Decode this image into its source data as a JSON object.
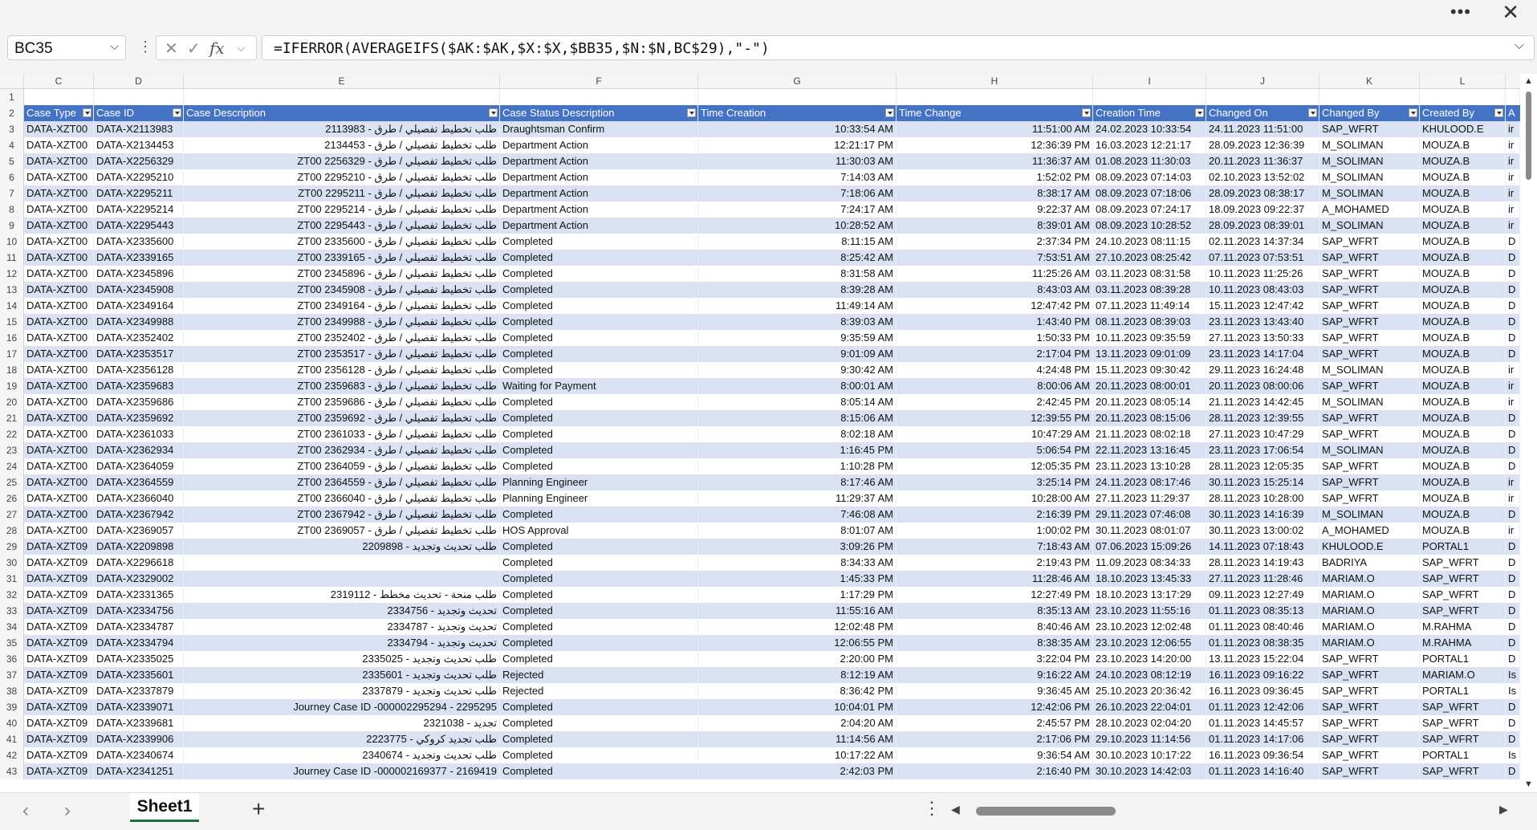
{
  "window": {
    "more_icon": "more-horizontal-icon",
    "close_icon": "close-icon"
  },
  "formula_bar": {
    "name_box": "BC35",
    "formula": "=IFERROR(AVERAGEIFS($AK:$AK,$X:$X,$BB35,$N:$N,BC$29),\"-\")"
  },
  "columns": [
    "C",
    "D",
    "E",
    "F",
    "G",
    "H",
    "I",
    "J",
    "K",
    "L"
  ],
  "headers": [
    "Case Type",
    "Case ID",
    "Case Description",
    "Case Status Description",
    "Time Creation",
    "Time Change",
    "Creation Time",
    "Changed On",
    "Changed By",
    "Created By",
    "A"
  ],
  "rows": [
    [
      "DATA-XZT00",
      "DATA-X2113983",
      "طلب تخطيط تفصيلي / طرق - 2113983",
      "Draughtsman Confirm",
      "10:33:54 AM",
      "11:51:00 AM",
      "24.02.2023 10:33:54",
      "24.11.2023 11:51:00",
      "SAP_WFRT",
      "KHULOOD.E",
      "ir"
    ],
    [
      "DATA-XZT00",
      "DATA-X2134453",
      "طلب تخطيط تفصيلي / طرق - 2134453",
      "Department Action",
      "12:21:17 PM",
      "12:36:39 PM",
      "16.03.2023 12:21:17",
      "28.09.2023 12:36:39",
      "M_SOLIMAN",
      "MOUZA.B",
      "ir"
    ],
    [
      "DATA-XZT00",
      "DATA-X2256329",
      "طلب تخطيط تفصيلي / طرق - ZT00 2256329",
      "Department Action",
      "11:30:03 AM",
      "11:36:37 AM",
      "01.08.2023 11:30:03",
      "20.11.2023 11:36:37",
      "M_SOLIMAN",
      "MOUZA.B",
      "ir"
    ],
    [
      "DATA-XZT00",
      "DATA-X2295210",
      "طلب تخطيط تفصيلي / طرق - ZT00 2295210",
      "Department Action",
      "7:14:03 AM",
      "1:52:02 PM",
      "08.09.2023 07:14:03",
      "02.10.2023 13:52:02",
      "M_SOLIMAN",
      "MOUZA.B",
      "ir"
    ],
    [
      "DATA-XZT00",
      "DATA-X2295211",
      "طلب تخطيط تفصيلي / طرق - ZT00 2295211",
      "Department Action",
      "7:18:06 AM",
      "8:38:17 AM",
      "08.09.2023 07:18:06",
      "28.09.2023 08:38:17",
      "M_SOLIMAN",
      "MOUZA.B",
      "ir"
    ],
    [
      "DATA-XZT00",
      "DATA-X2295214",
      "طلب تخطيط تفصيلي / طرق - ZT00 2295214",
      "Department Action",
      "7:24:17 AM",
      "9:22:37 AM",
      "08.09.2023 07:24:17",
      "18.09.2023 09:22:37",
      "A_MOHAMED",
      "MOUZA.B",
      "ir"
    ],
    [
      "DATA-XZT00",
      "DATA-X2295443",
      "طلب تخطيط تفصيلي / طرق - ZT00 2295443",
      "Department Action",
      "10:28:52 AM",
      "8:39:01 AM",
      "08.09.2023 10:28:52",
      "28.09.2023 08:39:01",
      "M_SOLIMAN",
      "MOUZA.B",
      "ir"
    ],
    [
      "DATA-XZT00",
      "DATA-X2335600",
      "طلب تخطيط تفصيلي / طرق - ZT00 2335600",
      "Completed",
      "8:11:15 AM",
      "2:37:34 PM",
      "24.10.2023 08:11:15",
      "02.11.2023 14:37:34",
      "SAP_WFRT",
      "MOUZA.B",
      "D"
    ],
    [
      "DATA-XZT00",
      "DATA-X2339165",
      "طلب تخطيط تفصيلي / طرق - ZT00 2339165",
      "Completed",
      "8:25:42 AM",
      "7:53:51 AM",
      "27.10.2023 08:25:42",
      "07.11.2023 07:53:51",
      "SAP_WFRT",
      "MOUZA.B",
      "D"
    ],
    [
      "DATA-XZT00",
      "DATA-X2345896",
      "طلب تخطيط تفصيلي / طرق - ZT00 2345896",
      "Completed",
      "8:31:58 AM",
      "11:25:26 AM",
      "03.11.2023 08:31:58",
      "10.11.2023 11:25:26",
      "SAP_WFRT",
      "MOUZA.B",
      "D"
    ],
    [
      "DATA-XZT00",
      "DATA-X2345908",
      "طلب تخطيط تفصيلي / طرق - ZT00 2345908",
      "Completed",
      "8:39:28 AM",
      "8:43:03 AM",
      "03.11.2023 08:39:28",
      "10.11.2023 08:43:03",
      "SAP_WFRT",
      "MOUZA.B",
      "D"
    ],
    [
      "DATA-XZT00",
      "DATA-X2349164",
      "طلب تخطيط تفصيلي / طرق - ZT00 2349164",
      "Completed",
      "11:49:14 AM",
      "12:47:42 PM",
      "07.11.2023 11:49:14",
      "15.11.2023 12:47:42",
      "SAP_WFRT",
      "MOUZA.B",
      "D"
    ],
    [
      "DATA-XZT00",
      "DATA-X2349988",
      "طلب تخطيط تفصيلي / طرق - ZT00 2349988",
      "Completed",
      "8:39:03 AM",
      "1:43:40 PM",
      "08.11.2023 08:39:03",
      "23.11.2023 13:43:40",
      "SAP_WFRT",
      "MOUZA.B",
      "D"
    ],
    [
      "DATA-XZT00",
      "DATA-X2352402",
      "طلب تخطيط تفصيلي / طرق - ZT00 2352402",
      "Completed",
      "9:35:59 AM",
      "1:50:33 PM",
      "10.11.2023 09:35:59",
      "27.11.2023 13:50:33",
      "SAP_WFRT",
      "MOUZA.B",
      "D"
    ],
    [
      "DATA-XZT00",
      "DATA-X2353517",
      "طلب تخطيط تفصيلي / طرق - ZT00 2353517",
      "Completed",
      "9:01:09 AM",
      "2:17:04 PM",
      "13.11.2023 09:01:09",
      "23.11.2023 14:17:04",
      "SAP_WFRT",
      "MOUZA.B",
      "D"
    ],
    [
      "DATA-XZT00",
      "DATA-X2356128",
      "طلب تخطيط تفصيلي / طرق - ZT00 2356128",
      "Completed",
      "9:30:42 AM",
      "4:24:48 PM",
      "15.11.2023 09:30:42",
      "29.11.2023 16:24:48",
      "M_SOLIMAN",
      "MOUZA.B",
      "ir"
    ],
    [
      "DATA-XZT00",
      "DATA-X2359683",
      "طلب تخطيط تفصيلي / طرق - ZT00 2359683",
      "Waiting for Payment",
      "8:00:01 AM",
      "8:00:06 AM",
      "20.11.2023 08:00:01",
      "20.11.2023 08:00:06",
      "SAP_WFRT",
      "MOUZA.B",
      "ir"
    ],
    [
      "DATA-XZT00",
      "DATA-X2359686",
      "طلب تخطيط تفصيلي / طرق - ZT00 2359686",
      "Completed",
      "8:05:14 AM",
      "2:42:45 PM",
      "20.11.2023 08:05:14",
      "21.11.2023 14:42:45",
      "M_SOLIMAN",
      "MOUZA.B",
      "ir"
    ],
    [
      "DATA-XZT00",
      "DATA-X2359692",
      "طلب تخطيط تفصيلي / طرق - ZT00 2359692",
      "Completed",
      "8:15:06 AM",
      "12:39:55 PM",
      "20.11.2023 08:15:06",
      "28.11.2023 12:39:55",
      "SAP_WFRT",
      "MOUZA.B",
      "D"
    ],
    [
      "DATA-XZT00",
      "DATA-X2361033",
      "طلب تخطيط تفصيلي / طرق - ZT00 2361033",
      "Completed",
      "8:02:18 AM",
      "10:47:29 AM",
      "21.11.2023 08:02:18",
      "27.11.2023 10:47:29",
      "SAP_WFRT",
      "MOUZA.B",
      "D"
    ],
    [
      "DATA-XZT00",
      "DATA-X2362934",
      "طلب تخطيط تفصيلي / طرق - ZT00 2362934",
      "Completed",
      "1:16:45 PM",
      "5:06:54 PM",
      "22.11.2023 13:16:45",
      "23.11.2023 17:06:54",
      "M_SOLIMAN",
      "MOUZA.B",
      "D"
    ],
    [
      "DATA-XZT00",
      "DATA-X2364059",
      "طلب تخطيط تفصيلي / طرق - ZT00 2364059",
      "Completed",
      "1:10:28 PM",
      "12:05:35 PM",
      "23.11.2023 13:10:28",
      "28.11.2023 12:05:35",
      "SAP_WFRT",
      "MOUZA.B",
      "D"
    ],
    [
      "DATA-XZT00",
      "DATA-X2364559",
      "طلب تخطيط تفصيلي / طرق - ZT00 2364559",
      "Planning Engineer",
      "8:17:46 AM",
      "3:25:14 PM",
      "24.11.2023 08:17:46",
      "30.11.2023 15:25:14",
      "SAP_WFRT",
      "MOUZA.B",
      "ir"
    ],
    [
      "DATA-XZT00",
      "DATA-X2366040",
      "طلب تخطيط تفصيلي / طرق - ZT00 2366040",
      "Planning Engineer",
      "11:29:37 AM",
      "10:28:00 AM",
      "27.11.2023 11:29:37",
      "28.11.2023 10:28:00",
      "SAP_WFRT",
      "MOUZA.B",
      "ir"
    ],
    [
      "DATA-XZT00",
      "DATA-X2367942",
      "طلب تخطيط تفصيلي / طرق - ZT00 2367942",
      "Completed",
      "7:46:08 AM",
      "2:16:39 PM",
      "29.11.2023 07:46:08",
      "30.11.2023 14:16:39",
      "M_SOLIMAN",
      "MOUZA.B",
      "D"
    ],
    [
      "DATA-XZT00",
      "DATA-X2369057",
      "طلب تخطيط تفصيلي / طرق - ZT00 2369057",
      "HOS Approval",
      "8:01:07 AM",
      "1:00:02 PM",
      "30.11.2023 08:01:07",
      "30.11.2023 13:00:02",
      "A_MOHAMED",
      "MOUZA.B",
      "ir"
    ],
    [
      "DATA-XZT09",
      "DATA-X2209898",
      "طلب تحديث وتجديد - 2209898",
      "Completed",
      "3:09:26 PM",
      "7:18:43 AM",
      "07.06.2023 15:09:26",
      "14.11.2023 07:18:43",
      "KHULOOD.E",
      "PORTAL1",
      "D"
    ],
    [
      "DATA-XZT09",
      "DATA-X2296618",
      "",
      "Completed",
      "8:34:33 AM",
      "2:19:43 PM",
      "11.09.2023 08:34:33",
      "28.11.2023 14:19:43",
      "BADRIYA",
      "SAP_WFRT",
      "D"
    ],
    [
      "DATA-XZT09",
      "DATA-X2329002",
      "",
      "Completed",
      "1:45:33 PM",
      "11:28:46 AM",
      "18.10.2023 13:45:33",
      "27.11.2023 11:28:46",
      "MARIAM.O",
      "SAP_WFRT",
      "D"
    ],
    [
      "DATA-XZT09",
      "DATA-X2331365",
      "طلب منحة - تحديث مخطط - 2319112",
      "Completed",
      "1:17:29 PM",
      "12:27:49 PM",
      "18.10.2023 13:17:29",
      "09.11.2023 12:27:49",
      "MARIAM.O",
      "SAP_WFRT",
      "D"
    ],
    [
      "DATA-XZT09",
      "DATA-X2334756",
      "تحديث وتجديد - 2334756",
      "Completed",
      "11:55:16 AM",
      "8:35:13 AM",
      "23.10.2023 11:55:16",
      "01.11.2023 08:35:13",
      "MARIAM.O",
      "SAP_WFRT",
      "D"
    ],
    [
      "DATA-XZT09",
      "DATA-X2334787",
      "تحديث وتجديد - 2334787",
      "Completed",
      "12:02:48 PM",
      "8:40:46 AM",
      "23.10.2023 12:02:48",
      "01.11.2023 08:40:46",
      "MARIAM.O",
      "M.RAHMA",
      "D"
    ],
    [
      "DATA-XZT09",
      "DATA-X2334794",
      "تحديث وتجديد - 2334794",
      "Completed",
      "12:06:55 PM",
      "8:38:35 AM",
      "23.10.2023 12:06:55",
      "01.11.2023 08:38:35",
      "MARIAM.O",
      "M.RAHMA",
      "D"
    ],
    [
      "DATA-XZT09",
      "DATA-X2335025",
      "طلب تحديث وتجديد - 2335025",
      "Completed",
      "2:20:00 PM",
      "3:22:04 PM",
      "23.10.2023 14:20:00",
      "13.11.2023 15:22:04",
      "SAP_WFRT",
      "PORTAL1",
      "D"
    ],
    [
      "DATA-XZT09",
      "DATA-X2335601",
      "طلب تحديث وتجديد - 2335601",
      "Rejected",
      "8:12:19 AM",
      "9:16:22 AM",
      "24.10.2023 08:12:19",
      "16.11.2023 09:16:22",
      "SAP_WFRT",
      "MARIAM.O",
      "Is"
    ],
    [
      "DATA-XZT09",
      "DATA-X2337879",
      "طلب تحديث وتجديد - 2337879",
      "Rejected",
      "8:36:42 PM",
      "9:36:45 AM",
      "25.10.2023 20:36:42",
      "16.11.2023 09:36:45",
      "SAP_WFRT",
      "PORTAL1",
      "Is"
    ],
    [
      "DATA-XZT09",
      "DATA-X2339071",
      "Journey Case ID -000002295294 - 2295295",
      "Completed",
      "10:04:01 PM",
      "12:42:06 PM",
      "26.10.2023 22:04:01",
      "01.11.2023 12:42:06",
      "SAP_WFRT",
      "SAP_WFRT",
      "D"
    ],
    [
      "DATA-XZT09",
      "DATA-X2339681",
      "تجديد - 2321038",
      "Completed",
      "2:04:20 AM",
      "2:45:57 PM",
      "28.10.2023 02:04:20",
      "01.11.2023 14:45:57",
      "SAP_WFRT",
      "SAP_WFRT",
      "D"
    ],
    [
      "DATA-XZT09",
      "DATA-X2339906",
      "طلب تجديد كروكي - 2223775",
      "Completed",
      "11:14:56 AM",
      "2:17:06 PM",
      "29.10.2023 11:14:56",
      "01.11.2023 14:17:06",
      "SAP_WFRT",
      "SAP_WFRT",
      "D"
    ],
    [
      "DATA-XZT09",
      "DATA-X2340674",
      "طلب تحديث وتجديد - 2340674",
      "Completed",
      "10:17:22 AM",
      "9:36:54 AM",
      "30.10.2023 10:17:22",
      "16.11.2023 09:36:54",
      "SAP_WFRT",
      "PORTAL1",
      "Is"
    ],
    [
      "DATA-XZT09",
      "DATA-X2341251",
      "Journey Case ID -000002169377 - 2169419",
      "Completed",
      "2:42:03 PM",
      "2:16:40 PM",
      "30.10.2023 14:42:03",
      "01.11.2023 14:16:40",
      "SAP_WFRT",
      "SAP_WFRT",
      "D"
    ]
  ],
  "sheet_tab": "Sheet1",
  "icons": {
    "prev": "chevron-left-icon",
    "next": "chevron-right-icon",
    "add": "plus-icon",
    "menu": "vertical-dots-icon"
  },
  "colors": {
    "header_fill": "#4472c4",
    "band_fill": "#d9e1f2",
    "tab_accent": "#1e6f3f"
  }
}
